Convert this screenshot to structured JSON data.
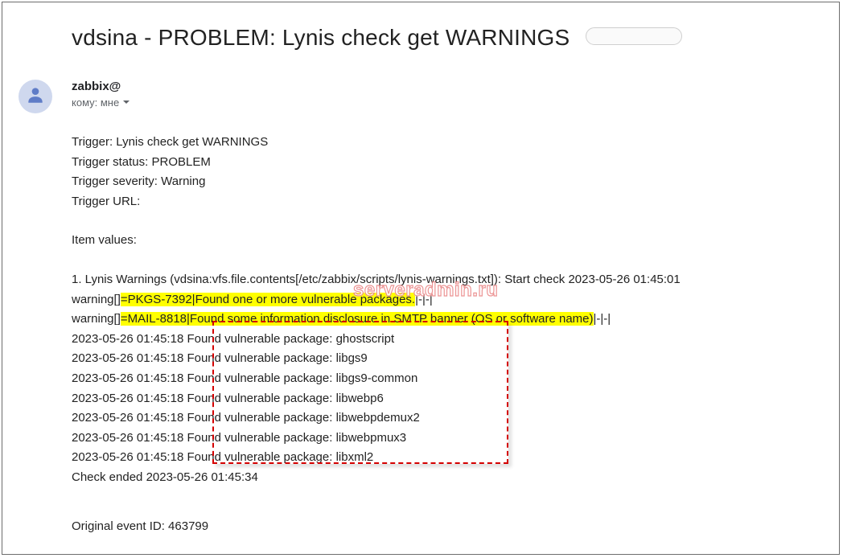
{
  "subject": "vdsina - PROBLEM: Lynis check get WARNINGS",
  "sender": "zabbix@",
  "recipient_line": "кому: мне",
  "watermark": "serveradmin.ru",
  "body": {
    "trigger": "Trigger: Lynis check get WARNINGS",
    "trigger_status": "Trigger status: PROBLEM",
    "trigger_severity": "Trigger severity: Warning",
    "trigger_url": "Trigger URL:",
    "item_values": "Item values:",
    "line1_pre": "1. Lynis Warnings (vdsina:vfs.file.contents[/etc/zabbix/scripts/lynis-warnings.txt]): Start check 2023-05-26 01:45:01",
    "warn1_pre": "warning[]",
    "warn1_hl": "=PKGS-7392|Found one or more vulnerable packages.",
    "warn1_post": "|-|-|",
    "warn2_pre": "warning[]",
    "warn2_hl": "=MAIL-8818|Found some information disclosure in SMTP banner (OS or software name)",
    "warn2_post": "|-|-|",
    "pkg1": "2023-05-26 01:45:18 Found vulnerable package: ghostscript",
    "pkg2": "2023-05-26 01:45:18 Found vulnerable package: libgs9",
    "pkg3": "2023-05-26 01:45:18 Found vulnerable package: libgs9-common",
    "pkg4": "2023-05-26 01:45:18 Found vulnerable package: libwebp6",
    "pkg5": "2023-05-26 01:45:18 Found vulnerable package: libwebpdemux2",
    "pkg6": "2023-05-26 01:45:18 Found vulnerable package: libwebpmux3",
    "pkg7": "2023-05-26 01:45:18 Found vulnerable package: libxml2",
    "check_ended": "Check ended 2023-05-26 01:45:34",
    "event_id": "Original event ID: 463799"
  }
}
